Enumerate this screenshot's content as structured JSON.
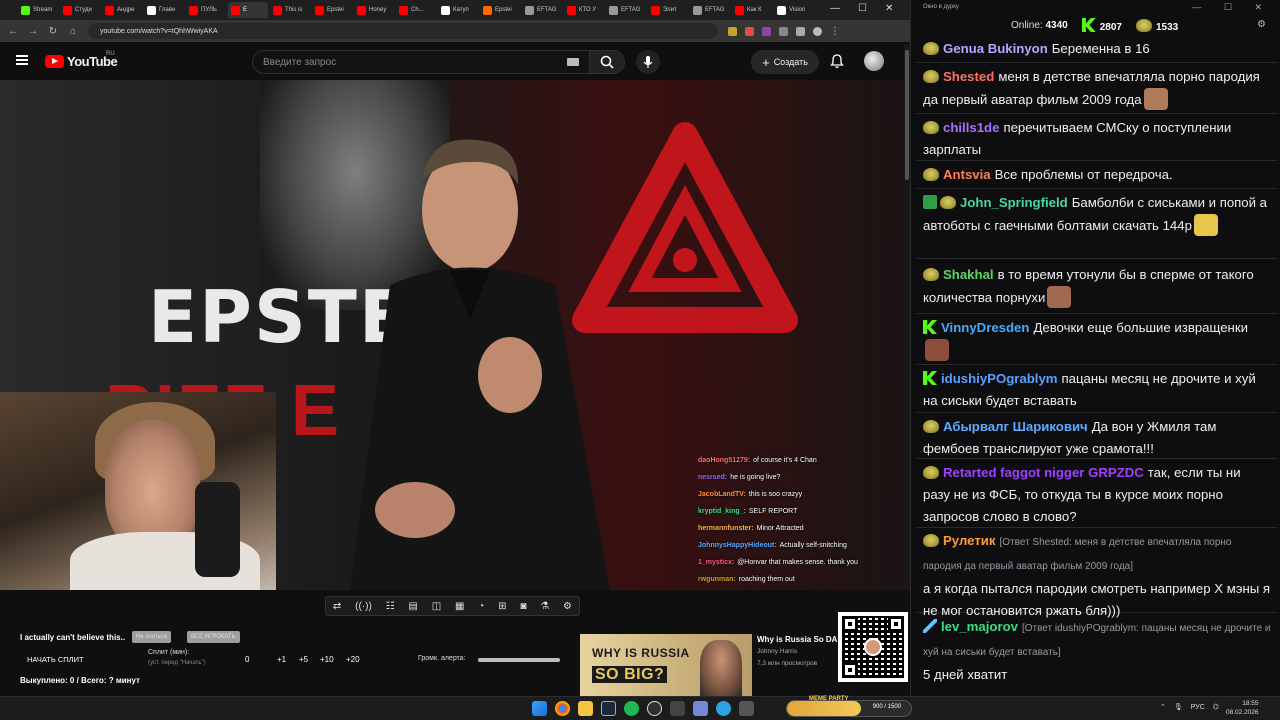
{
  "browser": {
    "tabs": [
      {
        "label": "Stream",
        "color": "#53fc18"
      },
      {
        "label": "Студи",
        "color": "#ff0000"
      },
      {
        "label": "Андре",
        "color": "#ff0000"
      },
      {
        "label": "Главн",
        "color": "#ffffff"
      },
      {
        "label": "ПУЛЬ",
        "color": "#ff0000"
      },
      {
        "label": "Е",
        "color": "#ff0000",
        "active": true
      },
      {
        "label": "This is",
        "color": "#ff0000"
      },
      {
        "label": "Epstei",
        "color": "#ff0000"
      },
      {
        "label": "Honey",
        "color": "#ff0000"
      },
      {
        "label": "Ch...",
        "color": "#ff0000"
      },
      {
        "label": "Катуп",
        "color": "#ffffff"
      },
      {
        "label": "Epstei",
        "color": "#ff6a00"
      },
      {
        "label": "EFTAG",
        "color": "#999999"
      },
      {
        "label": "КТО У",
        "color": "#ff0000"
      },
      {
        "label": "EFTAG",
        "color": "#999999"
      },
      {
        "label": "Элит",
        "color": "#ff0000"
      },
      {
        "label": "EFTAG",
        "color": "#999999"
      },
      {
        "label": "Как К",
        "color": "#ff0000"
      },
      {
        "label": "Vision",
        "color": "#ffffff"
      }
    ],
    "url": "youtube.com/watch?v=tQhhWwiyAKA"
  },
  "youtube": {
    "logo_text": "YouTube",
    "region": "RU",
    "search_placeholder": "Введите запрос",
    "create_label": "Создать"
  },
  "video": {
    "poster_white_text": "EPSTE",
    "poster_red_text": "PIZZ E",
    "overlay_chat": [
      {
        "user": "daoHong51279:",
        "user_color": "#ff6b6b",
        "text": "of course it's 4 Chan"
      },
      {
        "user": "nesrsed:",
        "user_color": "#8f6bff",
        "text": "he is going live?"
      },
      {
        "user": "JacobLandTV:",
        "user_color": "#ff8c42",
        "text": "this is soo crazyy"
      },
      {
        "user": "kryptid_king_:",
        "user_color": "#3ddc84",
        "text": "SELF REPORT"
      },
      {
        "user": "hermannfunster:",
        "user_color": "#ffb347",
        "text": "Minor Attracted"
      },
      {
        "user": "JohnnysHappyHideout:",
        "user_color": "#5aa9ff",
        "text": "Actually self-snitching"
      },
      {
        "user": "1_mysticx:",
        "user_color": "#ff5c8a",
        "text": "@Honvar that makes sense. thank you"
      },
      {
        "user": "rwgunman:",
        "user_color": "#c9a227",
        "text": "roaching them out"
      }
    ]
  },
  "panel": {
    "notice": "I actually can't believe this..",
    "chip1": "Не злиться",
    "chip2": "ВСЕ ИГРОКАТЬ",
    "start_split": "НАЧАТЬ СПЛИТ",
    "split_label": "Сплит (мин):",
    "split_sub": "(уст. перед \"Начать\")",
    "split_value": "0",
    "split_buttons": [
      "+1",
      "+5",
      "+10",
      "+20"
    ],
    "volume_label": "Громк. алерта:",
    "bought": "Выкуплено: 0 / Всего: ? минут"
  },
  "recommended": {
    "thumb_line1": "WHY IS RUSSIA",
    "thumb_line2": "SO BIG?",
    "title": "Why is Russia So DA",
    "author": "Johnny Harris",
    "views": "7,3 млн просмотров"
  },
  "chat": {
    "window_title": "Окно в дурку",
    "online_label": "Online:",
    "online_value": "4340",
    "kick_count": "2807",
    "other_count": "1533",
    "messages": [
      {
        "user": "Genua Bukinyon",
        "color": "#b3a7ff",
        "badge": "pepe",
        "text": "Беременна в 16"
      },
      {
        "user": "Shested",
        "color": "#ff6f61",
        "badge": "pepe",
        "text": "меня в детстве впечатляла порно пародия да первый аватар фильм 2009 года"
      },
      {
        "user": "chills1de",
        "color": "#a970ff",
        "badge": "pepe",
        "text": "перечитываем СМСку о поступлении зарплаты"
      },
      {
        "user": "Antsvia",
        "color": "#ff7f50",
        "badge": "pepe",
        "text": "Все проблемы от передроча."
      },
      {
        "user": "John_Springfield",
        "color": "#4ad6a8",
        "badge": "check",
        "text": "Бамболби с сиськами и попой а автоботы с гаечными болтами скачать 144р"
      },
      {
        "user": "Shakhal",
        "color": "#5fd35f",
        "badge": "pepe",
        "text": "в то время утонули бы в сперме от такого количества порнухи"
      },
      {
        "user": "VinnyDresden",
        "color": "#48a8ff",
        "badge": "kick",
        "text": "Девочки еще большие извращенки"
      },
      {
        "user": "idushiyPOgrablym",
        "color": "#5aa0ff",
        "badge": "kick",
        "text": "пацаны месяц не дрочите и хуй на сиськи будет вставать"
      },
      {
        "user": "Абырвалг Шарикович",
        "color": "#5da9ff",
        "badge": "pepe",
        "text": "Да вон у Жмиля там фембоев транслируют уже срамота!!!"
      },
      {
        "user": "Retarted faggot nigger GRPZDC",
        "color": "#a040ff",
        "badge": "pepe",
        "text": "так, если ты ни разу не из ФСБ, то откуда ты в курсе моих порно запросов слово в слово?"
      },
      {
        "user": "Рулетик",
        "color": "#ff9a3c",
        "badge": "pepe",
        "reply": "[Ответ Shested: меня в детстве впечатляла порно пародия да первый аватар фильм 2009 года]",
        "text": "а я когда пытался пародии смотреть например Х мэны я не мог остановится ржать бля)))"
      },
      {
        "user": "lev_majorov",
        "color": "#3ddc84",
        "badge": "sword",
        "reply": "[Ответ idushiyPOgrablym: пацаны месяц не дрочите и хуй на сиськи будет вставать]",
        "text": "5 дней хватит"
      }
    ]
  },
  "taskbar": {
    "meme_label": "MEME PARTY",
    "meme_count": "900 / 1500",
    "meme_progress": 0.6,
    "lang": "РУС",
    "time": "18:55",
    "date": "08.02.2026"
  }
}
